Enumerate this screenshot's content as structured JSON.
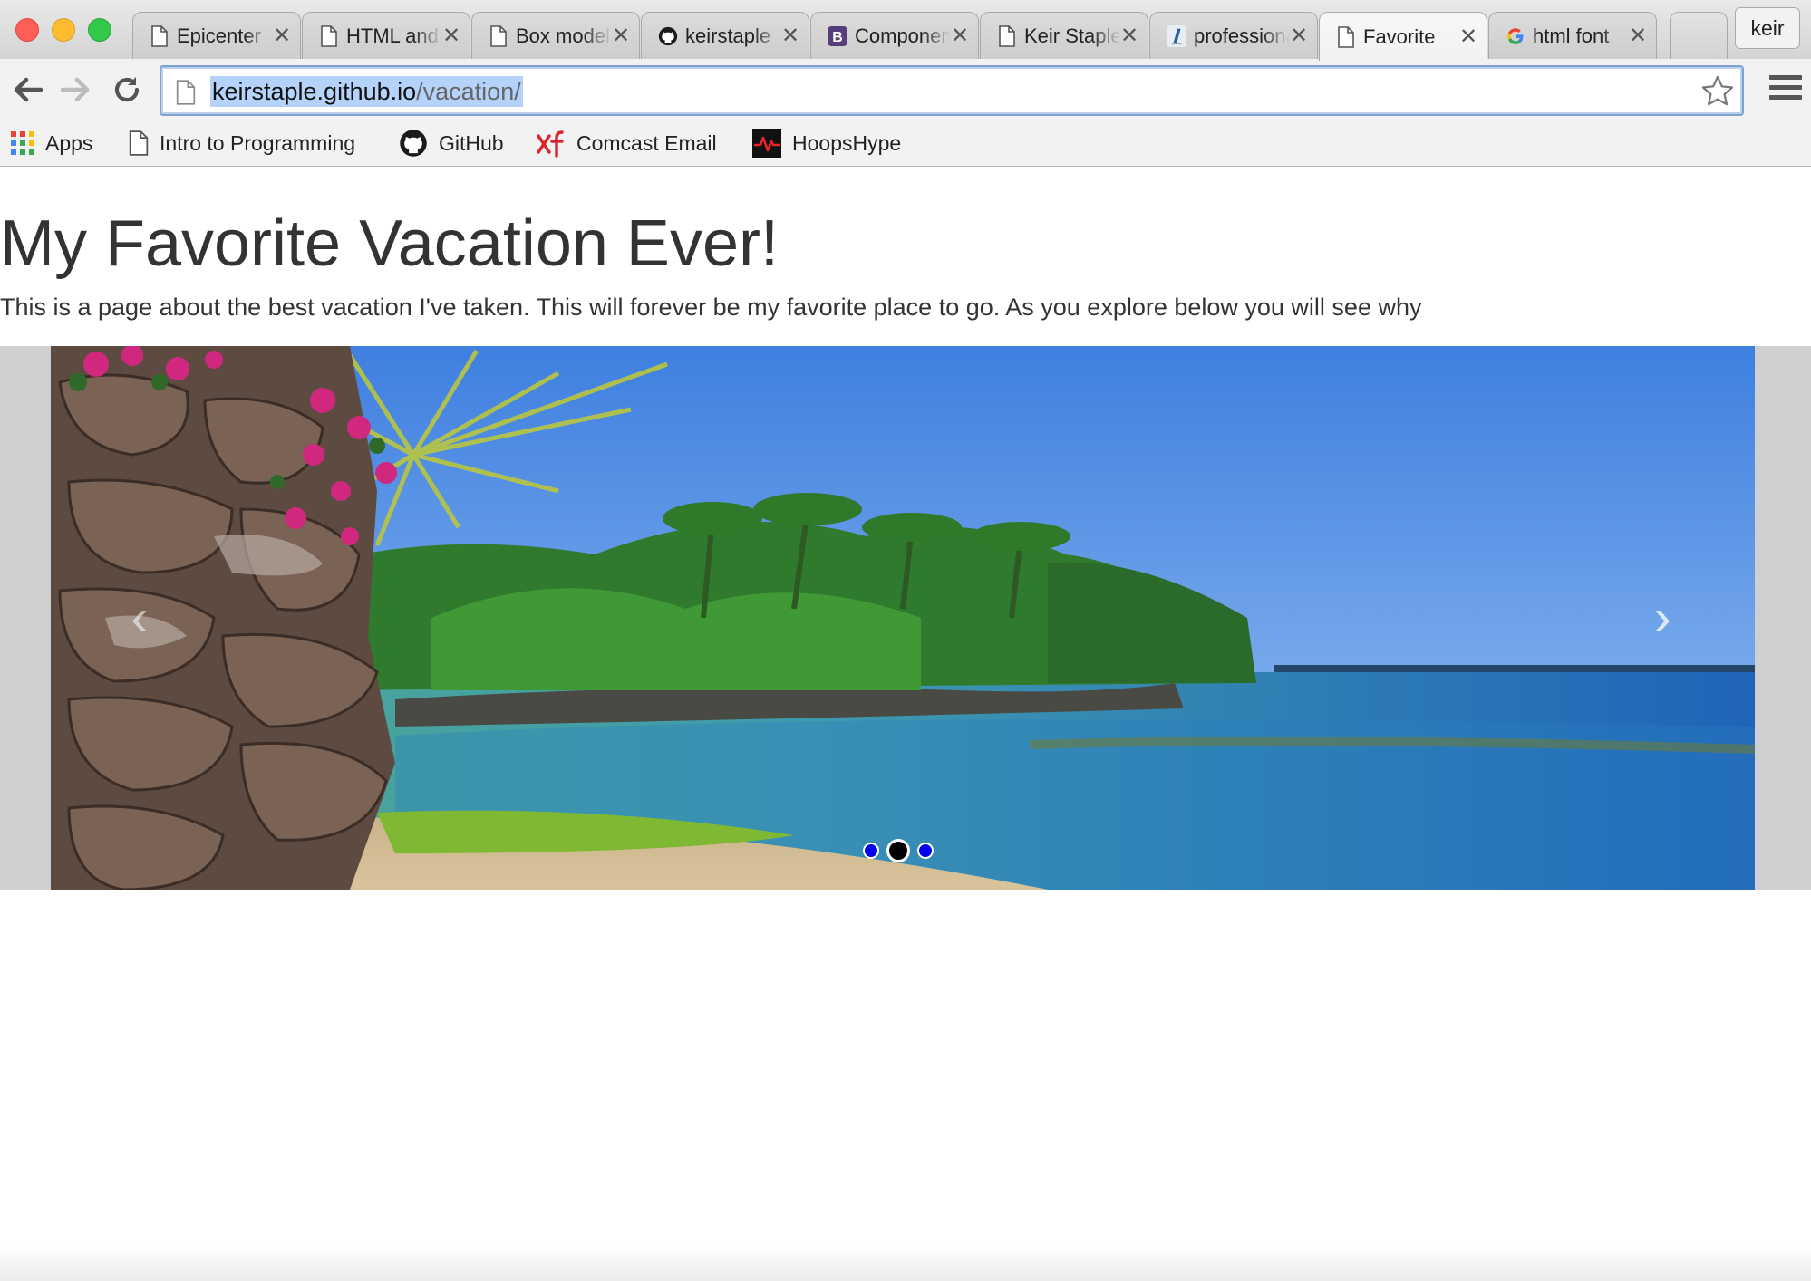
{
  "browser": {
    "tabs": [
      {
        "title": "Epicenter",
        "favicon": "page-icon",
        "active": false
      },
      {
        "title": "HTML and",
        "favicon": "page-icon",
        "active": false
      },
      {
        "title": "Box model",
        "favicon": "page-icon",
        "active": false
      },
      {
        "title": "keirstaple",
        "favicon": "github-icon",
        "active": false
      },
      {
        "title": "Components",
        "favicon": "bootstrap-icon",
        "active": false
      },
      {
        "title": "Keir Staple",
        "favicon": "page-icon",
        "active": false
      },
      {
        "title": "professional",
        "favicon": "lynda-icon",
        "active": false
      },
      {
        "title": "Favorite",
        "favicon": "page-icon",
        "active": true
      },
      {
        "title": "html font",
        "favicon": "google-icon",
        "active": false
      }
    ],
    "tab_close_glyph": "✕",
    "profile_name": "keir",
    "address": {
      "host": "keirstaple.github.io",
      "path": "/vacation/"
    },
    "bookmarks": [
      {
        "label": "Apps",
        "icon": "apps-grid-icon"
      },
      {
        "label": "Intro to Programming",
        "icon": "page-icon"
      },
      {
        "label": "GitHub",
        "icon": "github-icon"
      },
      {
        "label": "Comcast Email",
        "icon": "xfinity-icon"
      },
      {
        "label": "HoopsHype",
        "icon": "hoopshype-icon"
      }
    ],
    "colors": {
      "traffic_red": "#fc5f57",
      "traffic_yellow": "#fdbc2e",
      "traffic_green": "#34c84a",
      "url_selection": "#b5d3fa"
    }
  },
  "page": {
    "heading": "My Favorite Vacation Ever!",
    "intro": "This is a page about the best vacation I've taken. This will forever be my favorite place to go. As you explore below you will see why",
    "carousel": {
      "prev_glyph": "‹",
      "next_glyph": "›",
      "slide_count": 3,
      "active_index": 1,
      "indicator_color": "#0000ee"
    }
  }
}
